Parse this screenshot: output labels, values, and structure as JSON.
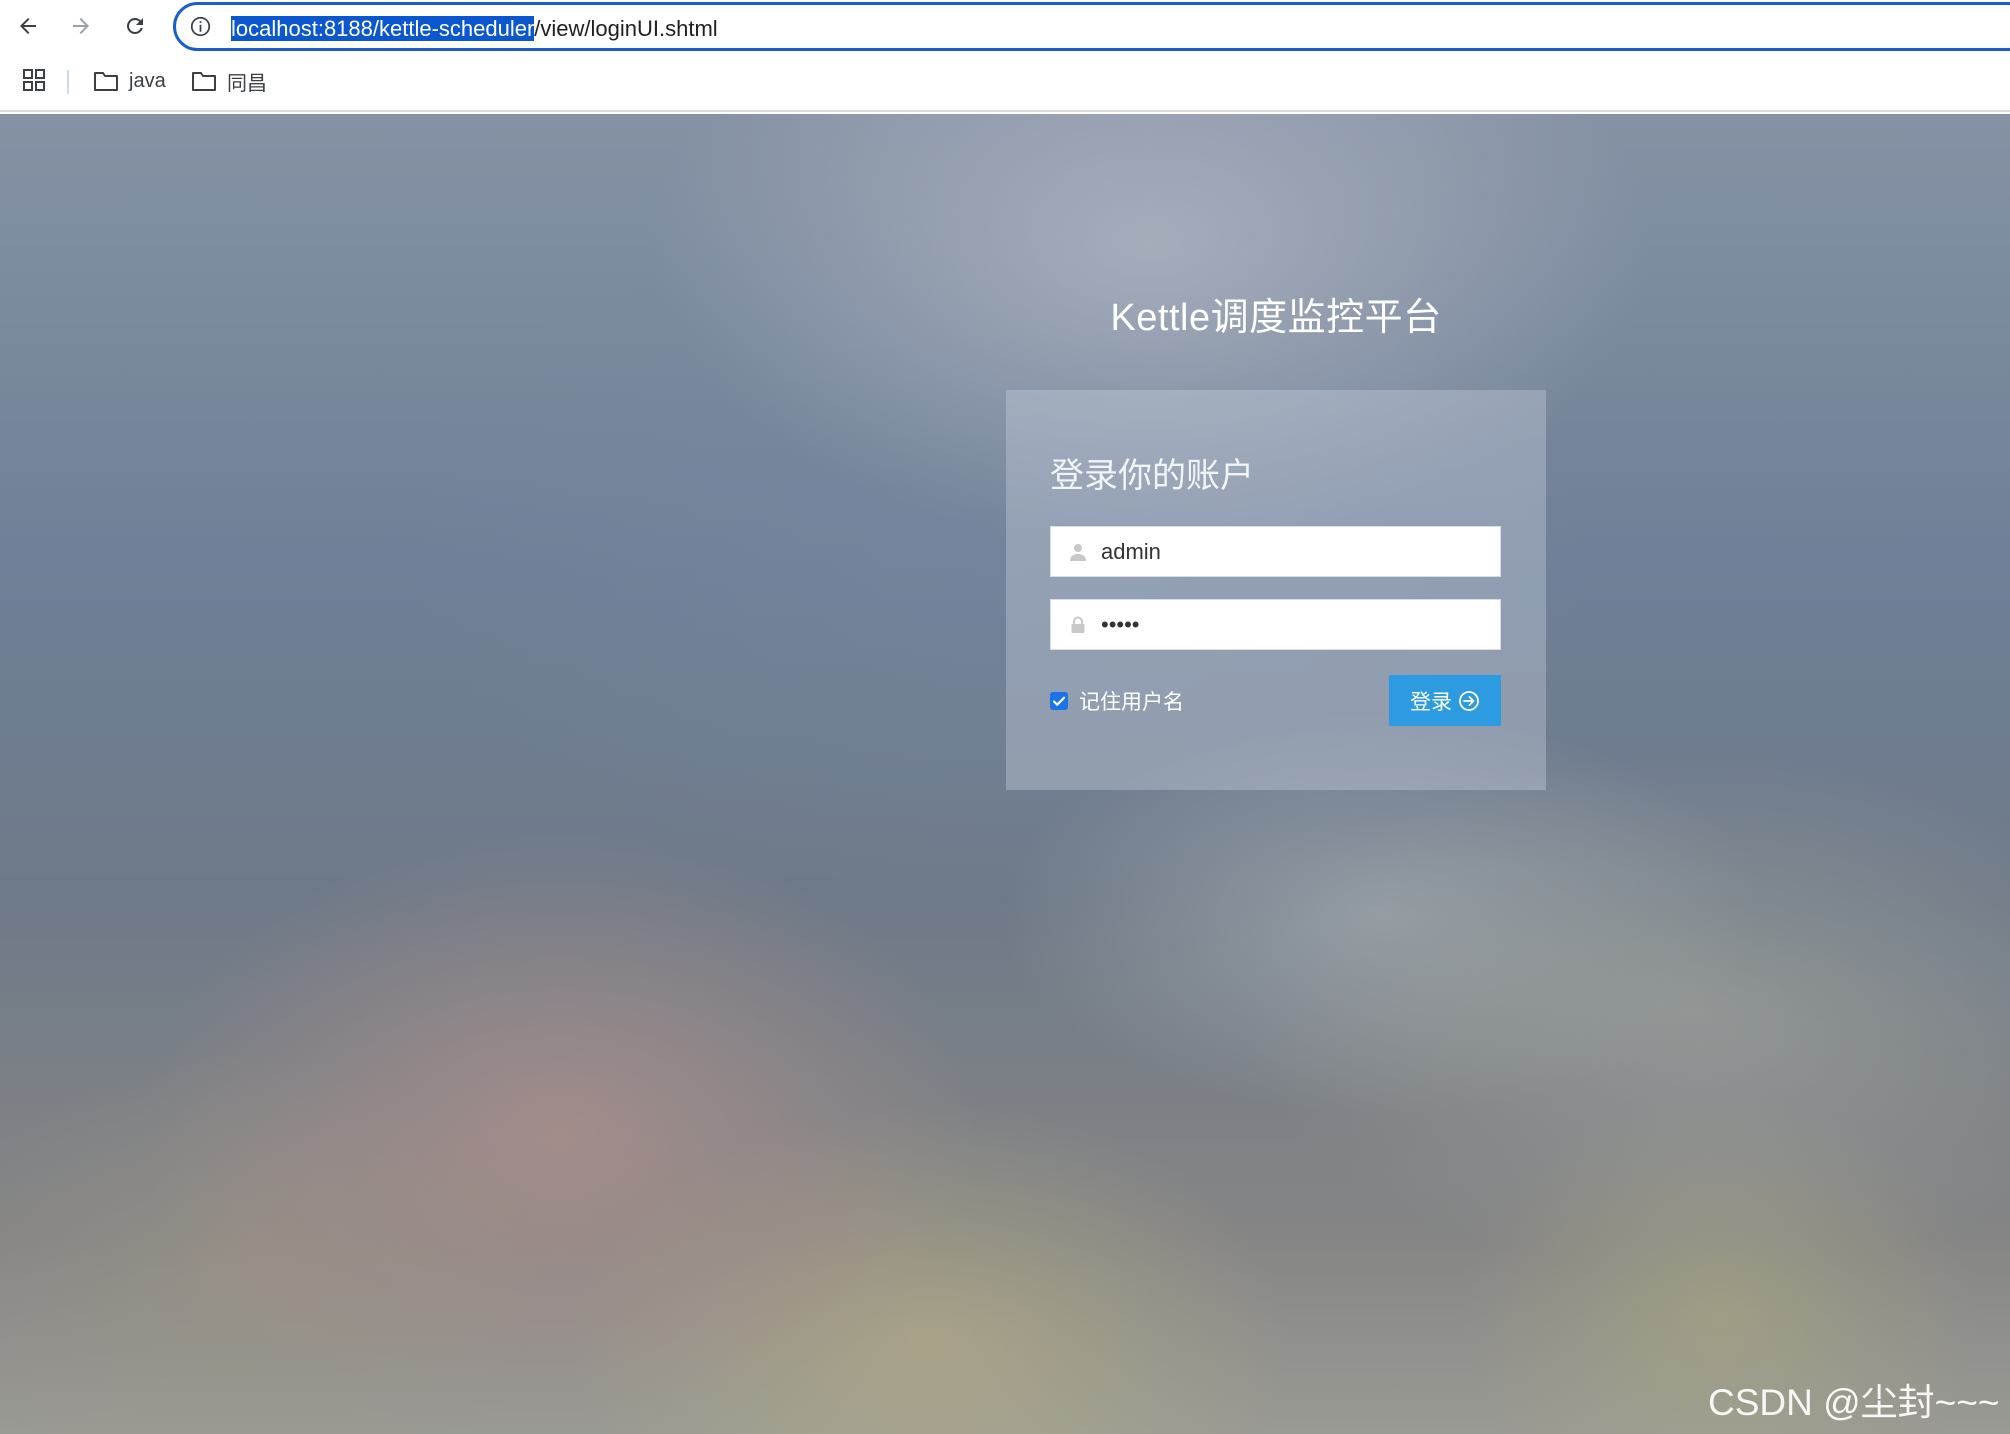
{
  "browser": {
    "url_selected": "localhost:8188/kettle-scheduler",
    "url_rest": "/view/loginUI.shtml",
    "bookmarks": [
      {
        "label": "java"
      },
      {
        "label": "同昌"
      }
    ]
  },
  "page": {
    "title": "Kettle调度监控平台",
    "login": {
      "heading": "登录你的账户",
      "username_value": "admin",
      "password_value": "•••••",
      "remember_label": "记住用户名",
      "remember_checked": true,
      "submit_label": "登录"
    },
    "watermark": "CSDN @尘封~~~"
  },
  "colors": {
    "omnibox_border": "#1a5fcc",
    "selection": "#0b57d0",
    "login_button": "#2c9be2",
    "checkbox": "#1a73e8"
  }
}
